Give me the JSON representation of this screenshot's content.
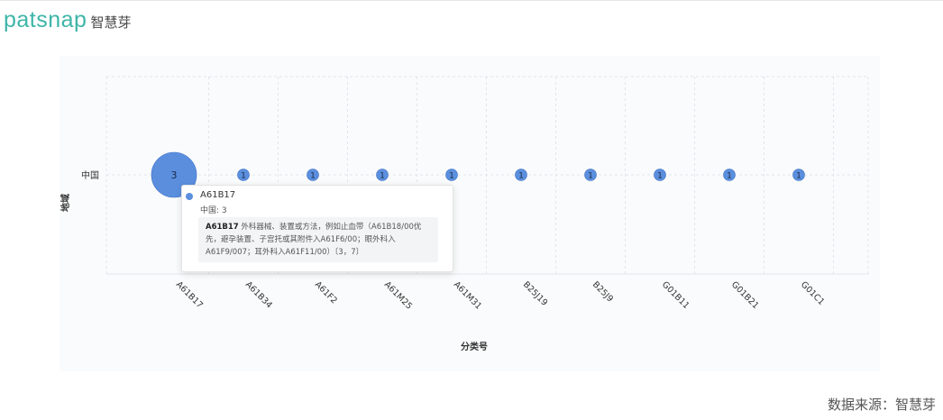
{
  "brand": {
    "name": "patsnap",
    "cn_name": "智慧芽"
  },
  "colors": {
    "bubble": "#5b8fde",
    "bubble_stroke": "#3a6fc4",
    "logo": "#3db5a8"
  },
  "chart_data": {
    "type": "scatter",
    "xlabel": "分类号",
    "ylabel": "地域",
    "categories": [
      "A61B17",
      "A61B34",
      "A61F2",
      "A61M25",
      "A61M31",
      "B25J19",
      "B25J9",
      "G01B11",
      "G01B21",
      "G01C1"
    ],
    "y_categories": [
      "中国"
    ],
    "series": [
      {
        "y": "中国",
        "values": [
          3,
          1,
          1,
          1,
          1,
          1,
          1,
          1,
          1,
          1
        ]
      }
    ],
    "grid": true,
    "tooltip": {
      "title": "A61B17",
      "value_line": "中国: 3",
      "desc_code": "A61B17",
      "desc_text": "外科器械、装置或方法，例如止血带（A61B18/00优先，避孕装置、子宫托或其附件入A61F6/00；眼外科入A61F9/007；耳外科入A61F11/00）〔3，7〕"
    }
  },
  "footer": {
    "source": "数据来源：智慧芽"
  }
}
